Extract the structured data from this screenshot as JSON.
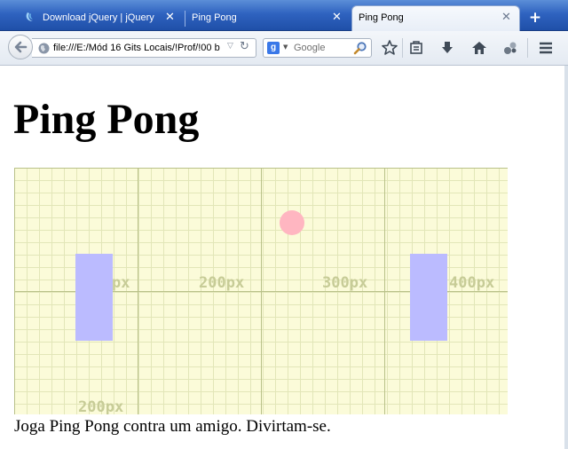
{
  "browser": {
    "tabs": [
      {
        "title": "Download jQuery | jQuery",
        "active": false,
        "icon": "jquery-icon"
      },
      {
        "title": "Ping Pong",
        "active": false,
        "icon": null
      },
      {
        "title": "Ping Pong",
        "active": true,
        "icon": null
      }
    ],
    "tab_close_glyph": "✕",
    "new_tab_glyph": "+",
    "url": "file:///E:/Mód 16 Gits Locais/!Prof/!00 b",
    "search_placeholder": "Google",
    "search_engine_glyph": "g",
    "toolbar_icons": [
      "back-icon",
      "globe-icon",
      "reload-icon",
      "magnifier-icon",
      "star-icon",
      "reading-list-icon",
      "download-icon",
      "home-icon",
      "addon-icon",
      "menu-icon"
    ],
    "colors": {
      "tabstrip": "#2f63c0",
      "active_tab": "#eef3fa"
    }
  },
  "page": {
    "title": "Ping Pong",
    "description": "Joga Ping Pong contra um amigo. Divirtam-se.",
    "canvas": {
      "ruler_labels": [
        "px",
        "200px",
        "300px",
        "400px",
        "200px"
      ],
      "colors": {
        "background": "#fbfbd9",
        "paddle": "#bbbbff",
        "ball": "#ffb6c1"
      }
    }
  }
}
